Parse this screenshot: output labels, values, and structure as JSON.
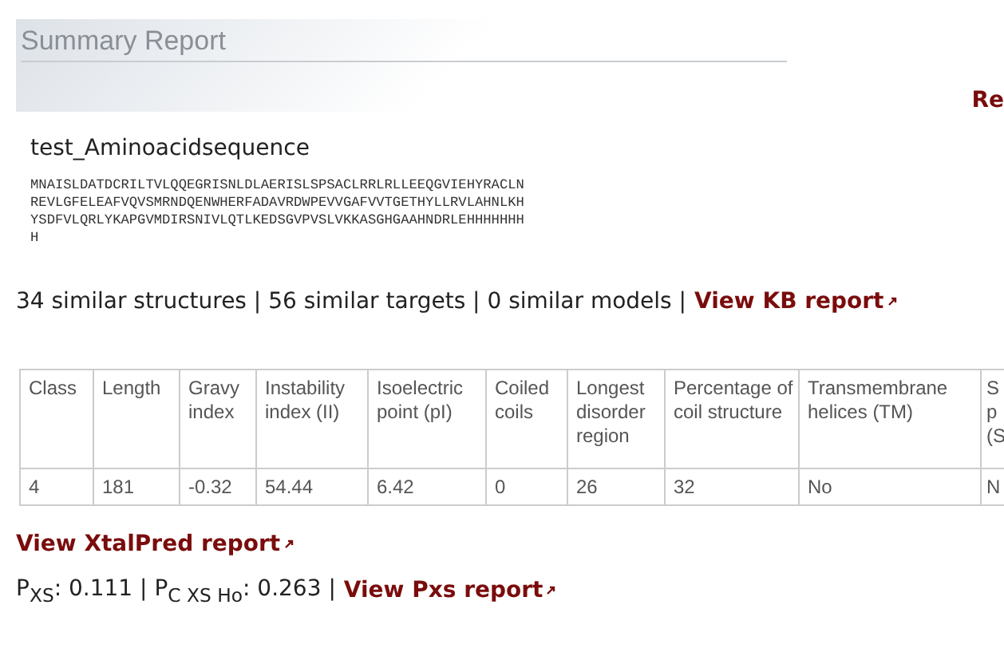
{
  "header": {
    "title": "Summary Report"
  },
  "corner_link": "Re",
  "target": {
    "name": "test_Aminoacidsequence",
    "sequence": [
      "MNAISLDATDCRILTVLQQEGRISNLDLAERISLSPSACLRRLRLLEEQGVIEHYRACLN",
      "REVLGFELEAFVQVSMRNDQENWHERFADAVRDWPEVVGAFVVTGETHYLLRVLAHNLKH",
      "YSDFVLQRLYKAPGVMDIRSNIVLQTLKEDSGVPVSLVKKASGHGAAHNDRLEHHHHHHH",
      "H"
    ]
  },
  "similarity": {
    "text": "34 similar structures | 56 similar targets | 0 similar models |",
    "link": "View KB report"
  },
  "table": {
    "columns": [
      "Class",
      "Length",
      "Gravy index",
      "Instability index (II)",
      "Isoelectric point (pI)",
      "Coiled coils",
      "Longest disorder region",
      "Percentage of coil structure",
      "Transmembrane helices (TM)",
      "S p (S"
    ],
    "rows": [
      [
        "4",
        "181",
        "-0.32",
        "54.44",
        "6.42",
        "0",
        "26",
        "32",
        "No",
        "N"
      ]
    ]
  },
  "xtalpred_link": "View XtalPred report",
  "pxs": {
    "text": "P$_{XS}$: 0.111 | P$_{C XS Ho}$: 0.263 |",
    "link": "View Pxs report"
  }
}
